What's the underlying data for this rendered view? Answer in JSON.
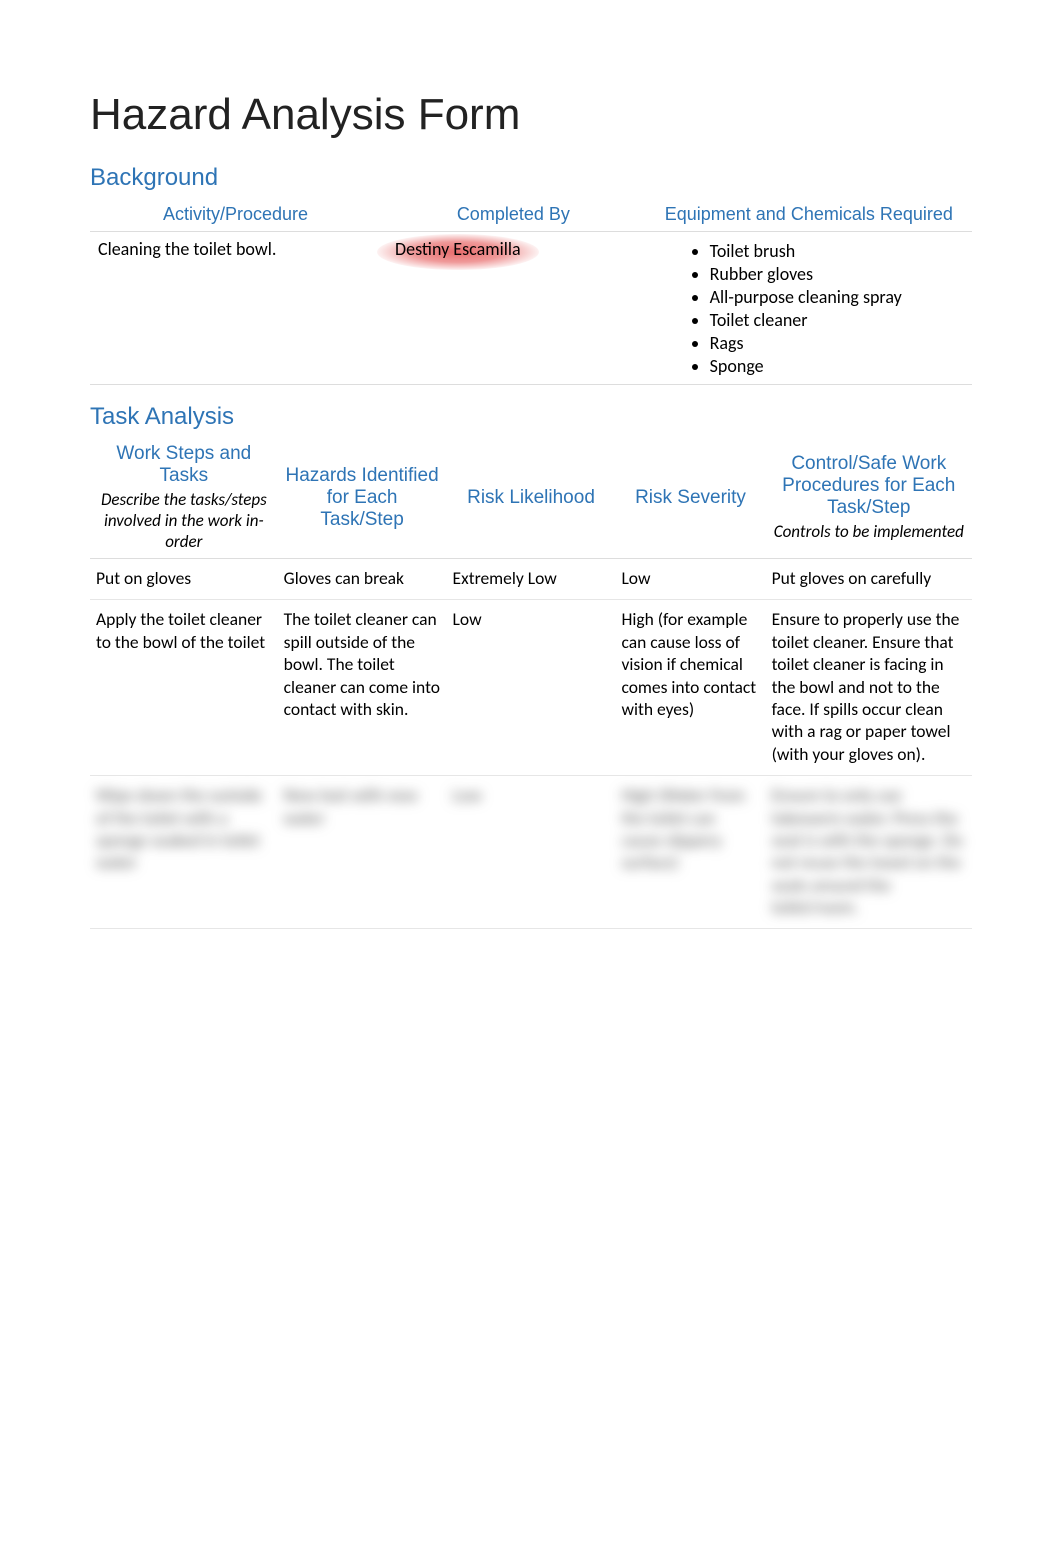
{
  "title": "Hazard Analysis Form",
  "background": {
    "heading": "Background",
    "headers": {
      "activity": "Activity/Procedure",
      "completed_by": "Completed By",
      "equipment": "Equipment and Chemicals Required"
    },
    "activity_value": "Cleaning the toilet bowl.",
    "completed_by_value": "Destiny Escamilla",
    "equipment_items": [
      "Toilet brush",
      "Rubber gloves",
      " All-purpose cleaning spray",
      "Toilet cleaner",
      "Rags",
      "Sponge"
    ]
  },
  "task_analysis": {
    "heading": "Task Analysis",
    "headers": {
      "work_steps": "Work Steps and Tasks",
      "work_steps_sub": "Describe the tasks/steps involved in the work in-order",
      "hazards": "Hazards Identified for Each Task/Step",
      "risk_likelihood": "Risk Likelihood",
      "risk_severity": "Risk Severity",
      "controls": "Control/Safe Work Procedures for Each Task/Step",
      "controls_sub": "Controls to be implemented"
    },
    "rows": [
      {
        "work_steps": "Put on gloves",
        "hazards": "Gloves can break",
        "risk_likelihood": "Extremely Low",
        "risk_severity": "Low",
        "controls": "Put gloves on carefully"
      },
      {
        "work_steps": "Apply the toilet cleaner to the bowl of the toilet",
        "hazards": "The toilet cleaner can spill outside of the bowl. The toilet cleaner can come into contact with skin.",
        "risk_likelihood": "Low",
        "risk_severity": "High (for example can cause loss of vision if chemical comes into contact with eyes)",
        "controls": "Ensure to properly use the toilet cleaner. Ensure that toilet cleaner is facing in the bowl and not to the face. If spills occur clean with a rag or paper towel (with your gloves on)."
      }
    ],
    "blurred_row": {
      "work_steps": "Wipe down the outside of the toilet with a sponge soaked in toilet water",
      "hazards": "New text with new water",
      "risk_likelihood": "Low",
      "risk_severity": "High (Water from the toilet can cause slippery surface)",
      "controls": "Ensure to only use lukewarm water. Press the seat is with the sponge. Do not reuse the towel on the seats around the toilet/room."
    }
  }
}
